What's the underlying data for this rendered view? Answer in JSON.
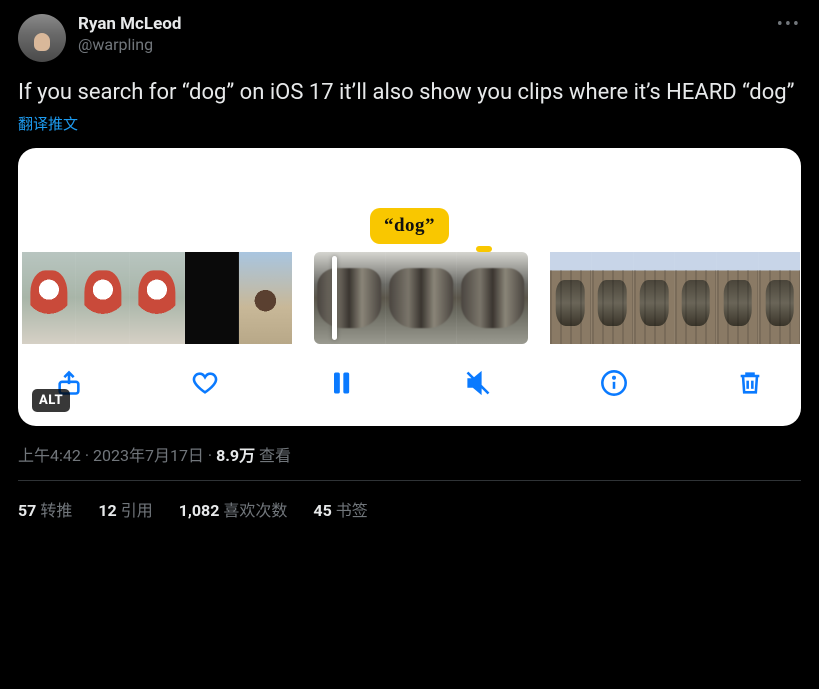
{
  "author": {
    "display_name": "Ryan McLeod",
    "handle": "@warpling"
  },
  "more_label": "•••",
  "body": "If you search for “dog” on iOS 17 it’ll also show you clips where it’s HEARD “dog”",
  "translate": "翻译推文",
  "media": {
    "caption_label": "“dog”",
    "alt_badge": "ALT"
  },
  "meta": {
    "time": "上午4:42",
    "sep": " · ",
    "date": "2023年7月17日",
    "views_num": "8.9万",
    "views_label": " 查看"
  },
  "stats": {
    "retweets_num": "57",
    "retweets_label": "转推",
    "quotes_num": "12",
    "quotes_label": "引用",
    "likes_num": "1,082",
    "likes_label": "喜欢次数",
    "bookmarks_num": "45",
    "bookmarks_label": "书签"
  }
}
